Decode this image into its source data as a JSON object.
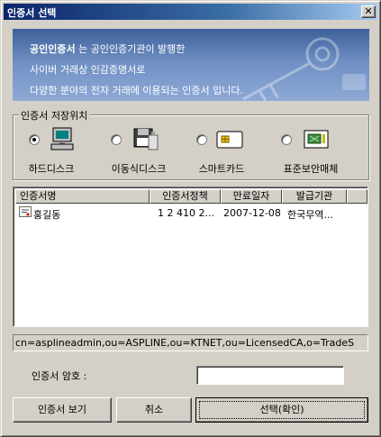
{
  "window": {
    "title": "인증서 선택",
    "close_glyph": "✕"
  },
  "banner": {
    "line1_bold": "공인인증서",
    "line1_rest": " 는 공인인증기관이 발행한",
    "line2": "사이버 거래상 인감증명서로",
    "line3": "다양한 분야의 전자 거래에 이용되는 인증서 입니다."
  },
  "storage": {
    "legend": "인증서 저장위치",
    "options": [
      {
        "label": "하드디스크",
        "icon": "computer-icon",
        "selected": true
      },
      {
        "label": "이동식디스크",
        "icon": "floppy-disk-icon",
        "selected": false
      },
      {
        "label": "스마트카드",
        "icon": "smart-card-icon",
        "selected": false
      },
      {
        "label": "표준보안매체",
        "icon": "security-token-icon",
        "selected": false
      }
    ]
  },
  "cert_list": {
    "columns": [
      "인증서명",
      "인증서정책",
      "만료일자",
      "발급기관"
    ],
    "rows": [
      {
        "name": "홍길동",
        "policy": "1 2 410 2...",
        "expiry": "2007-12-08",
        "issuer": "한국무역..."
      }
    ]
  },
  "subject_dn": "cn=asplineadmin,ou=ASPLINE,ou=KTNET,ou=LicensedCA,o=TradeS",
  "password": {
    "label": "인증서 암호 :",
    "value": ""
  },
  "buttons": {
    "view": "인증서 보기",
    "cancel": "취소",
    "select": "선택(확인)"
  },
  "colors": {
    "titlebar": "#0a246a",
    "banner": "#5a7ab0",
    "face": "#d4d0c8"
  }
}
